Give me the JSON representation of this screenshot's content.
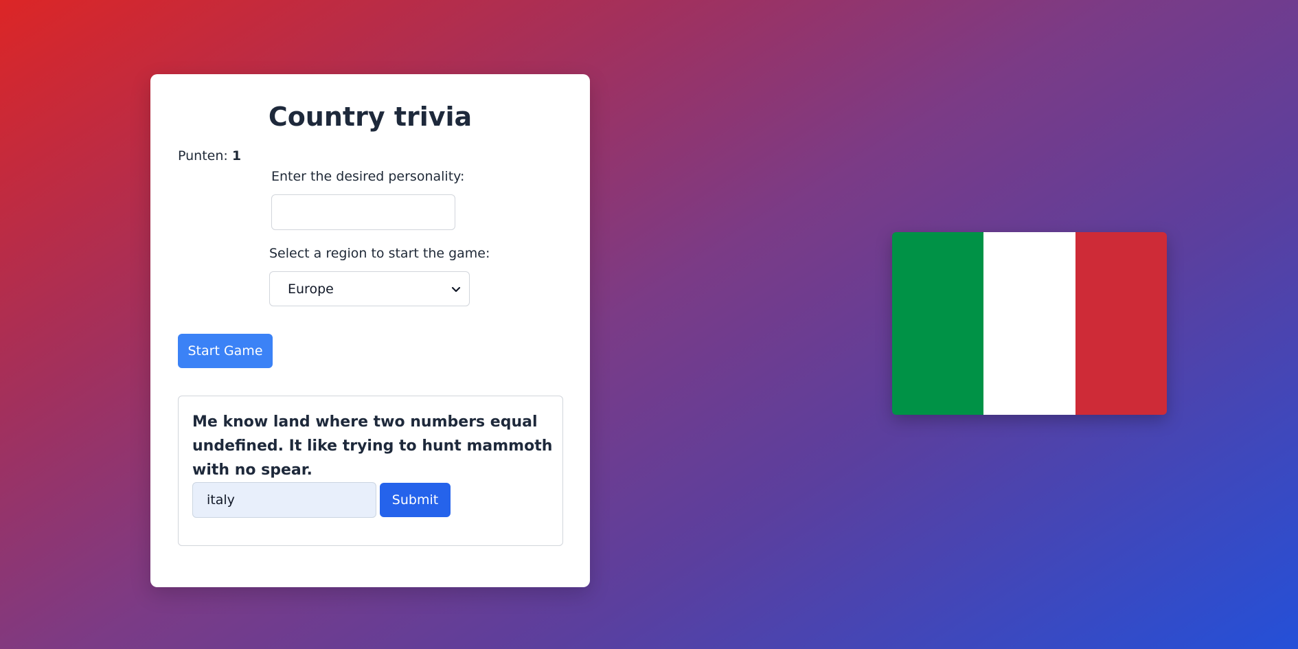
{
  "app": {
    "title": "Country trivia"
  },
  "score": {
    "label": "Punten:",
    "value": "1"
  },
  "personality": {
    "label": "Enter the desired personality:",
    "value": "",
    "placeholder": ""
  },
  "region": {
    "label": "Select a region to start the game:",
    "selected": "Europe"
  },
  "start_button": {
    "label": "Start Game"
  },
  "question": {
    "text": "Me know land where two numbers equal undefined. It like trying to hunt mammoth with no spear.",
    "answer_value": "italy",
    "submit_label": "Submit"
  },
  "flag": {
    "country": "Italy",
    "colors": [
      "#009246",
      "#ffffff",
      "#ce2b37"
    ]
  },
  "icons": {
    "select_chevron": "chevron-down-icon"
  }
}
